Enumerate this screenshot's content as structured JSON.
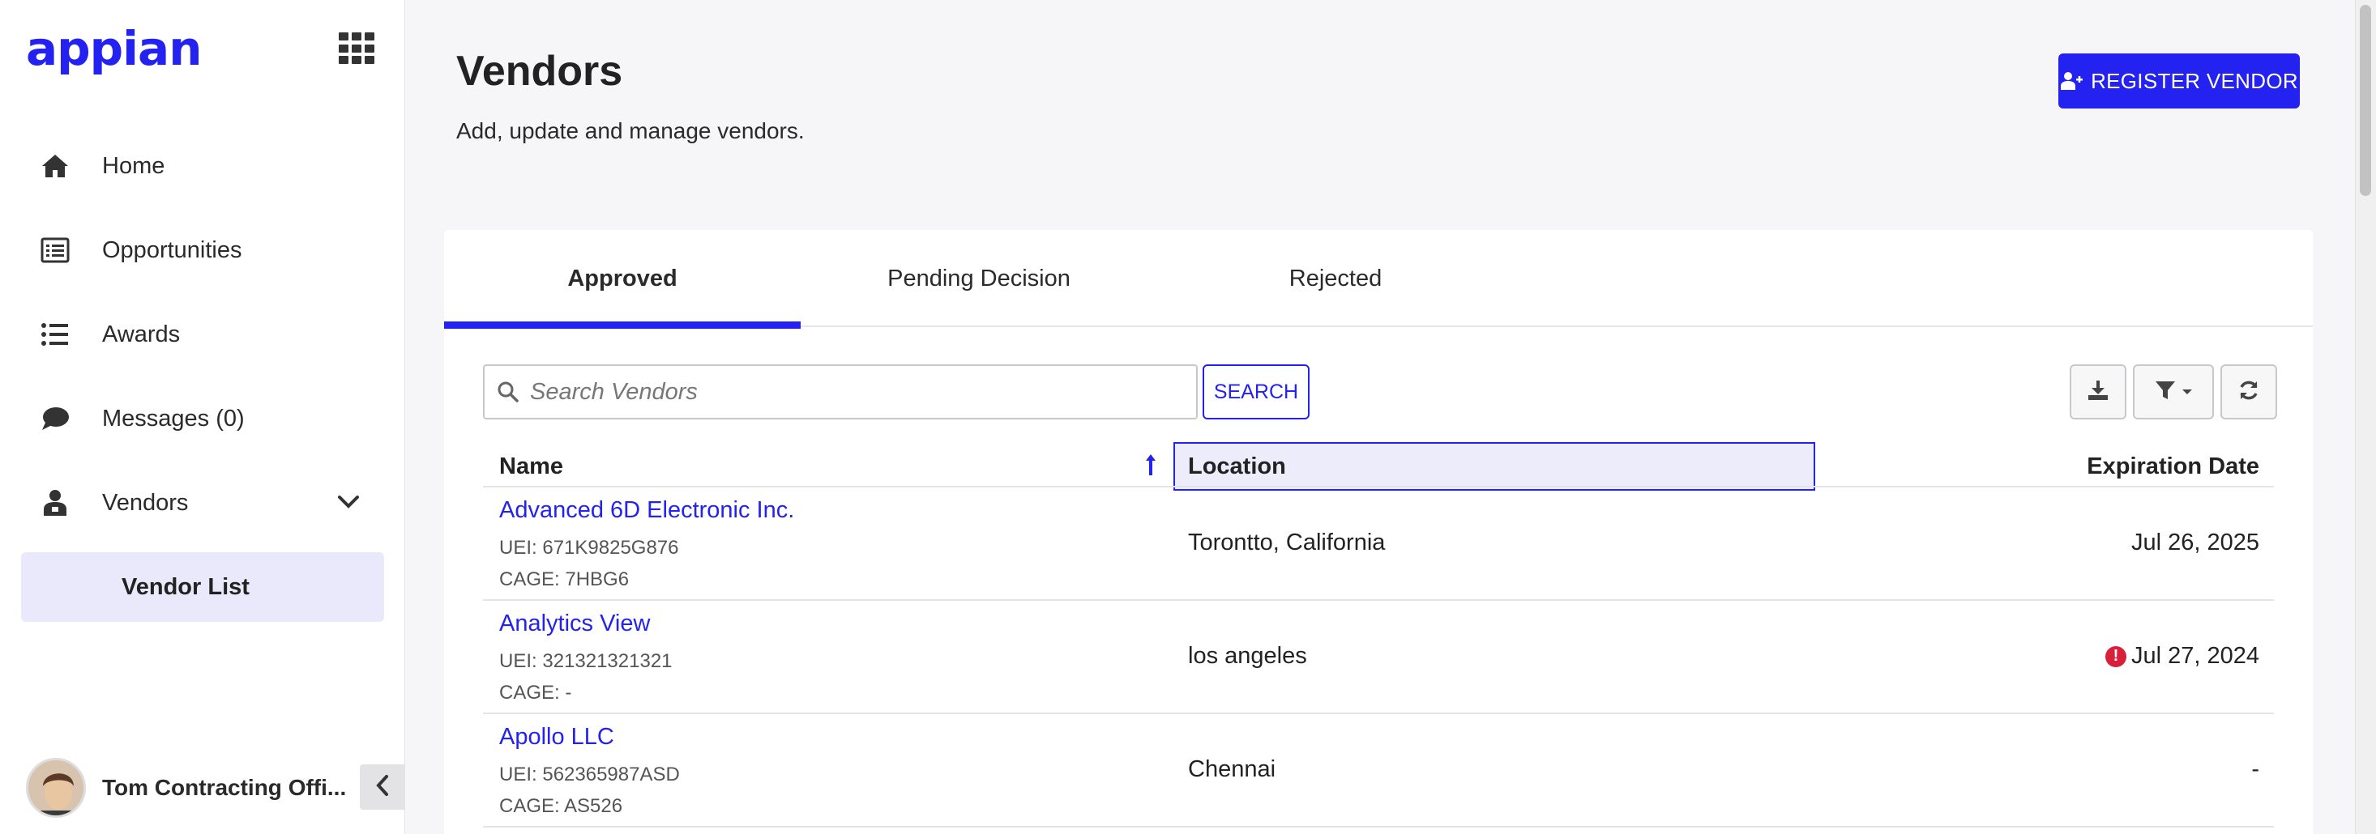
{
  "app": {
    "logo": "appian"
  },
  "colors": {
    "accent": "#2322f0",
    "alert": "#d8203a"
  },
  "sidebar": {
    "items": [
      {
        "label": "Home",
        "icon": "home-icon"
      },
      {
        "label": "Opportunities",
        "icon": "list-alt-icon"
      },
      {
        "label": "Awards",
        "icon": "list-icon"
      },
      {
        "label": "Messages (0)",
        "icon": "comment-icon"
      },
      {
        "label": "Vendors",
        "icon": "user-icon"
      }
    ],
    "subitem": "Vendor List",
    "user_name": "Tom Contracting Offi..."
  },
  "header": {
    "title": "Vendors",
    "subtitle": "Add, update and manage vendors.",
    "register_label": "REGISTER VENDOR"
  },
  "tabs": [
    "Approved",
    "Pending Decision",
    "Rejected"
  ],
  "search": {
    "placeholder": "Search Vendors",
    "button_label": "SEARCH"
  },
  "table": {
    "columns": [
      "Name",
      "Location",
      "Expiration Date"
    ],
    "rows": [
      {
        "name": "Advanced 6D Electronic Inc.",
        "uei": "UEI: 671K9825G876",
        "cage": "CAGE: 7HBG6",
        "location": "Torontto, California",
        "expiration": "Jul 26, 2025",
        "alert": false
      },
      {
        "name": "Analytics View",
        "uei": "UEI: 321321321321",
        "cage": "CAGE: -",
        "location": "los angeles",
        "expiration": "Jul 27, 2024",
        "alert": true,
        "alert_glyph": "!"
      },
      {
        "name": "Apollo LLC",
        "uei": "UEI: 562365987ASD",
        "cage": "CAGE: AS526",
        "location": "Chennai",
        "expiration": "-",
        "alert": false
      }
    ]
  }
}
